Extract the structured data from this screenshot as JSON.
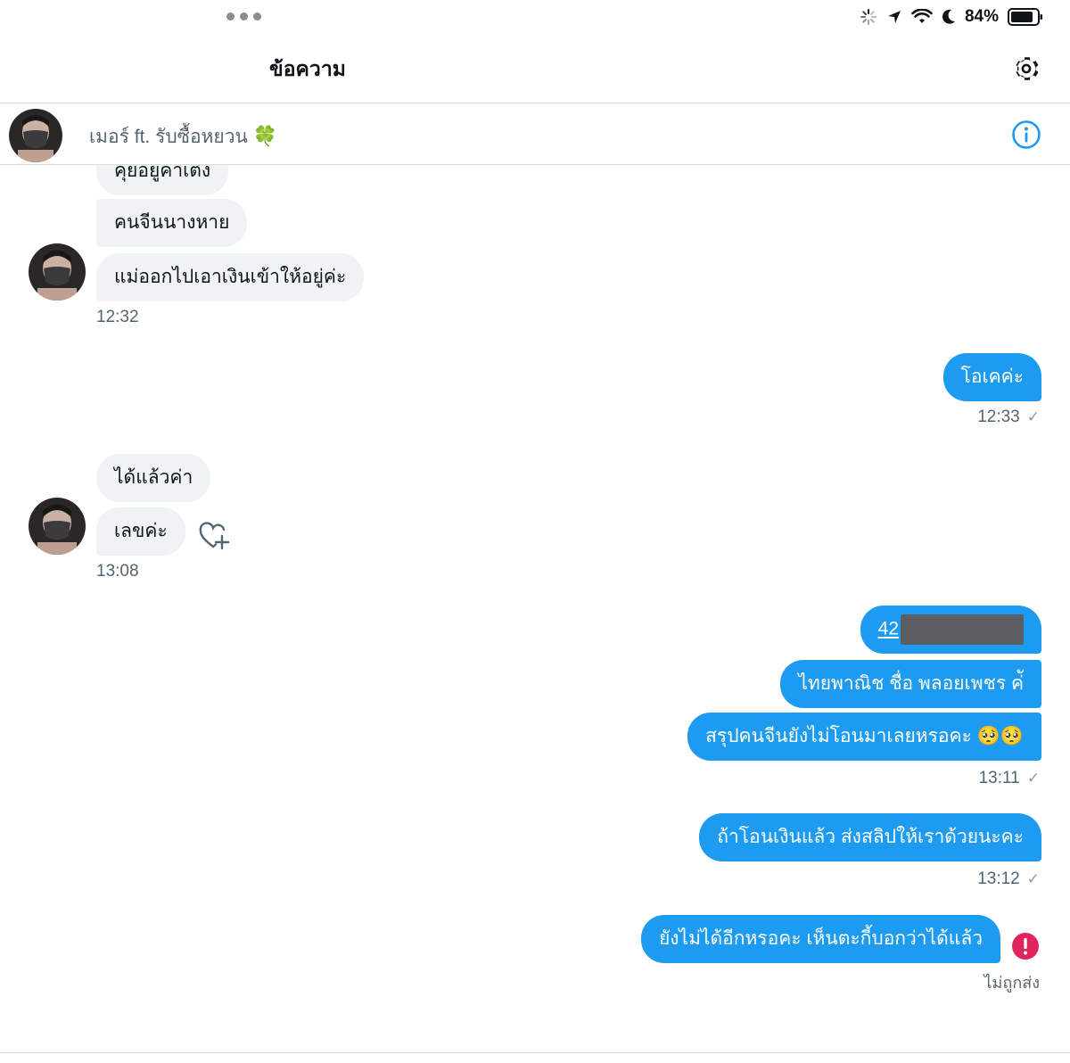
{
  "status": {
    "battery": "84%"
  },
  "header": {
    "title": "ข้อความ"
  },
  "conversation": {
    "name": "เมอร์ ft. รับซื้อหยวน",
    "emoji": "🍀"
  },
  "messages": {
    "group1": {
      "bubbles": [
        "คุยอยู่ค่าเต๋ง",
        "คนจีนนางหาย",
        "แม่ออกไปเอาเงินเข้าให้อยู่ค่ะ"
      ],
      "time": "12:32"
    },
    "group2": {
      "bubble": "โอเคค่ะ",
      "time": "12:33"
    },
    "group3": {
      "bubbles": [
        "ได้แล้วค่า",
        "เลขค่ะ"
      ],
      "time": "13:08"
    },
    "group4": {
      "link_prefix": "42",
      "bubbles": [
        "ไทยพาณิช ชื่อ พลอยเพชร ค่ั",
        "สรุปคนจีนยังไม่โอนมาเลยหรอคะ 🥺🥺"
      ],
      "time": "13:11"
    },
    "group5": {
      "bubble": "ถ้าโอนเงินแล้ว ส่งสลิปให้เราด้วยนะคะ",
      "time": "13:12"
    },
    "group6": {
      "bubble": "ยังไม่ได้อีกหรอคะ เห็นตะกี้บอกว่าได้แล้ว",
      "status": "ไม่ถูกส่ง"
    }
  },
  "colors": {
    "accent": "#1d9bf0",
    "incoming": "#eff3f4",
    "error": "#e0245e"
  },
  "icons": [
    "ellipsis-icon",
    "loading-icon",
    "location-arrow-icon",
    "wifi-icon",
    "moon-icon",
    "battery-icon",
    "gear-icon",
    "info-icon",
    "heart-add-icon",
    "error-icon",
    "check-icon"
  ]
}
